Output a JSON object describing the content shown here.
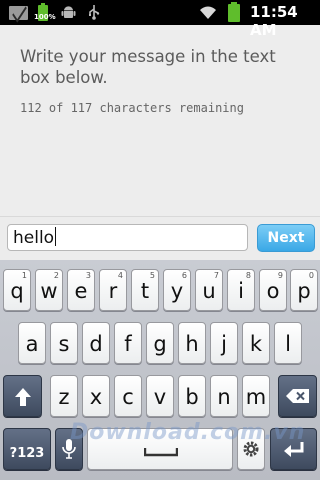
{
  "status_bar": {
    "battery_small_percent": "100%",
    "time": "11:54 AM",
    "icons": [
      "mail-icon",
      "battery-small-icon",
      "android-icon",
      "usb-icon",
      "wifi-icon",
      "battery-icon"
    ]
  },
  "main": {
    "instruction": "Write your message in the text box below.",
    "counter": "112 of 117 characters remaining"
  },
  "input": {
    "value": "hello",
    "next_label": "Next"
  },
  "keyboard": {
    "row1": [
      {
        "ch": "q",
        "num": "1"
      },
      {
        "ch": "w",
        "num": "2"
      },
      {
        "ch": "e",
        "num": "3"
      },
      {
        "ch": "r",
        "num": "4"
      },
      {
        "ch": "t",
        "num": "5"
      },
      {
        "ch": "y",
        "num": "6"
      },
      {
        "ch": "u",
        "num": "7"
      },
      {
        "ch": "i",
        "num": "8"
      },
      {
        "ch": "o",
        "num": "9"
      },
      {
        "ch": "p",
        "num": "0"
      }
    ],
    "row2": [
      "a",
      "s",
      "d",
      "f",
      "g",
      "h",
      "j",
      "k",
      "l"
    ],
    "row3": [
      "z",
      "x",
      "c",
      "v",
      "b",
      "n",
      "m"
    ],
    "symbols_label": "?123",
    "icons": [
      "shift-icon",
      "delete-icon",
      "microphone-icon",
      "space-icon",
      "settings-icon",
      "enter-icon"
    ]
  },
  "watermark": "Download.com.vn",
  "colors": {
    "next_button": "#3aa8e6",
    "battery": "#5fbd2c"
  }
}
